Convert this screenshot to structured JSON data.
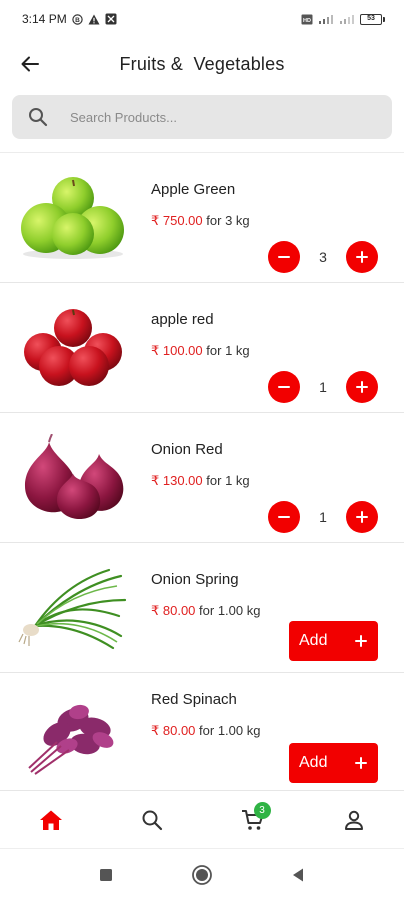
{
  "status_bar": {
    "time": "3:14 PM",
    "battery": "53"
  },
  "header": {
    "title": "Fruits &  Vegetables"
  },
  "search": {
    "placeholder": "Search Products...",
    "value": ""
  },
  "theme": {
    "accent": "#f20000",
    "price_color": "#e02020",
    "badge_color": "#2fb344"
  },
  "products": [
    {
      "name": "Apple Green",
      "price": "₹ 750.00",
      "unit": "for 3 kg",
      "quantity": "3",
      "image_icon": "green-apples"
    },
    {
      "name": "apple red",
      "price": "₹ 100.00",
      "unit": "for 1 kg",
      "quantity": "1",
      "image_icon": "red-apples"
    },
    {
      "name": "Onion Red",
      "price": "₹ 130.00",
      "unit": "for 1 kg",
      "quantity": "1",
      "image_icon": "red-onions"
    },
    {
      "name": "Onion Spring",
      "price": "₹ 80.00",
      "unit": "for 1.00 kg",
      "add_label": "Add",
      "image_icon": "spring-onion"
    },
    {
      "name": "Red Spinach",
      "price": "₹ 80.00",
      "unit": "for 1.00 kg",
      "add_label": "Add",
      "image_icon": "red-spinach"
    }
  ],
  "bottom_nav": {
    "items": [
      {
        "icon": "home-icon",
        "active": true
      },
      {
        "icon": "search-icon",
        "active": false
      },
      {
        "icon": "cart-icon",
        "active": false
      },
      {
        "icon": "profile-icon",
        "active": false
      }
    ],
    "cart_count": "3"
  },
  "system_nav": {
    "items": [
      "recents-icon",
      "home-circle-icon",
      "back-triangle-icon"
    ]
  }
}
